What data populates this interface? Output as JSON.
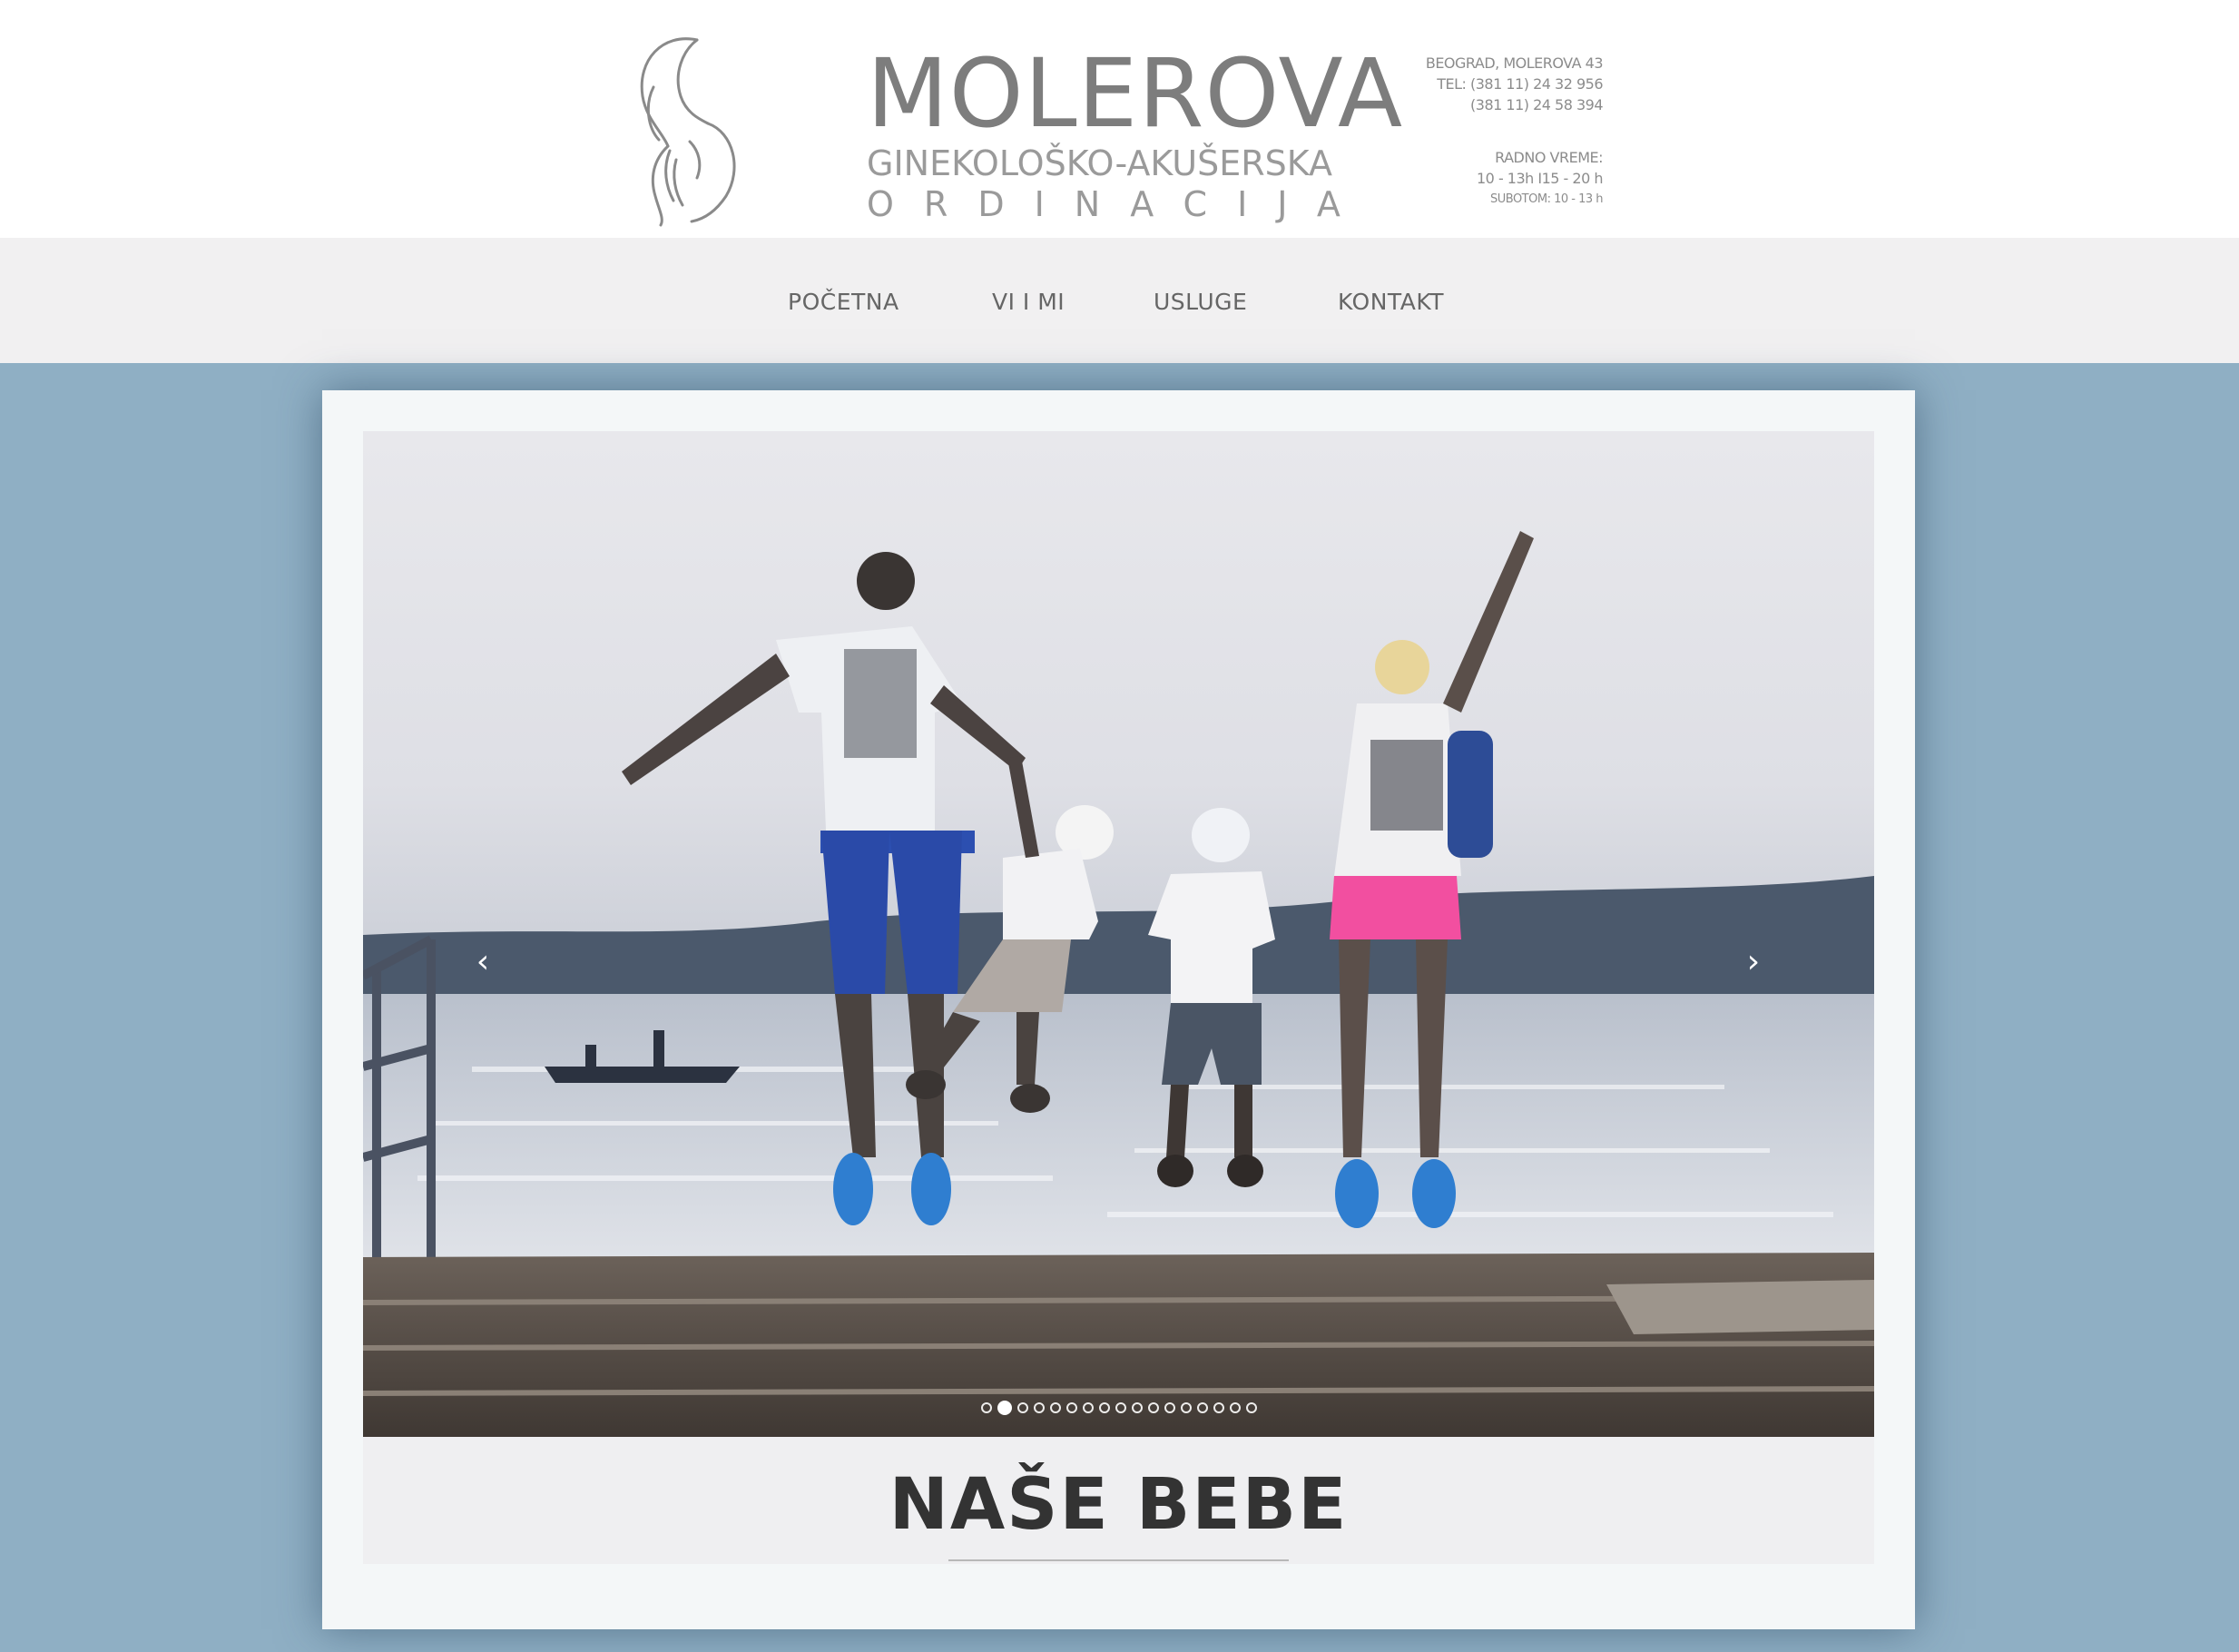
{
  "header": {
    "brand_name": "MOLEROVA",
    "brand_subtitle": "GINEKOLOŠKO-AKUŠERSKA",
    "brand_subtitle2": "ORDINACIJA",
    "contact": {
      "address": "BEOGRAD, MOLEROVA 43",
      "phone1": "TEL: (381 11) 24 32 956",
      "phone2": "(381 11) 24 58 394",
      "hours_title": "RADNO VREME:",
      "hours_weekday": "10 - 13h I15 - 20 h",
      "hours_saturday": "SUBOTOM: 10 - 13 h"
    }
  },
  "nav": {
    "items": [
      {
        "label": "POČETNA"
      },
      {
        "label": "VI I MI"
      },
      {
        "label": "USLUGE"
      },
      {
        "label": "KONTAKT"
      }
    ]
  },
  "slider": {
    "prev_glyph": "‹",
    "next_glyph": "›",
    "slide_count": 17,
    "active_slide": 2
  },
  "caption": {
    "title": "NAŠE BEBE"
  },
  "colors": {
    "page_background": "#8fafc4",
    "header_background": "#ffffff",
    "nav_background": "#f1f0f1",
    "brand_text": "#7d7d7d",
    "caption_text": "#333333"
  }
}
